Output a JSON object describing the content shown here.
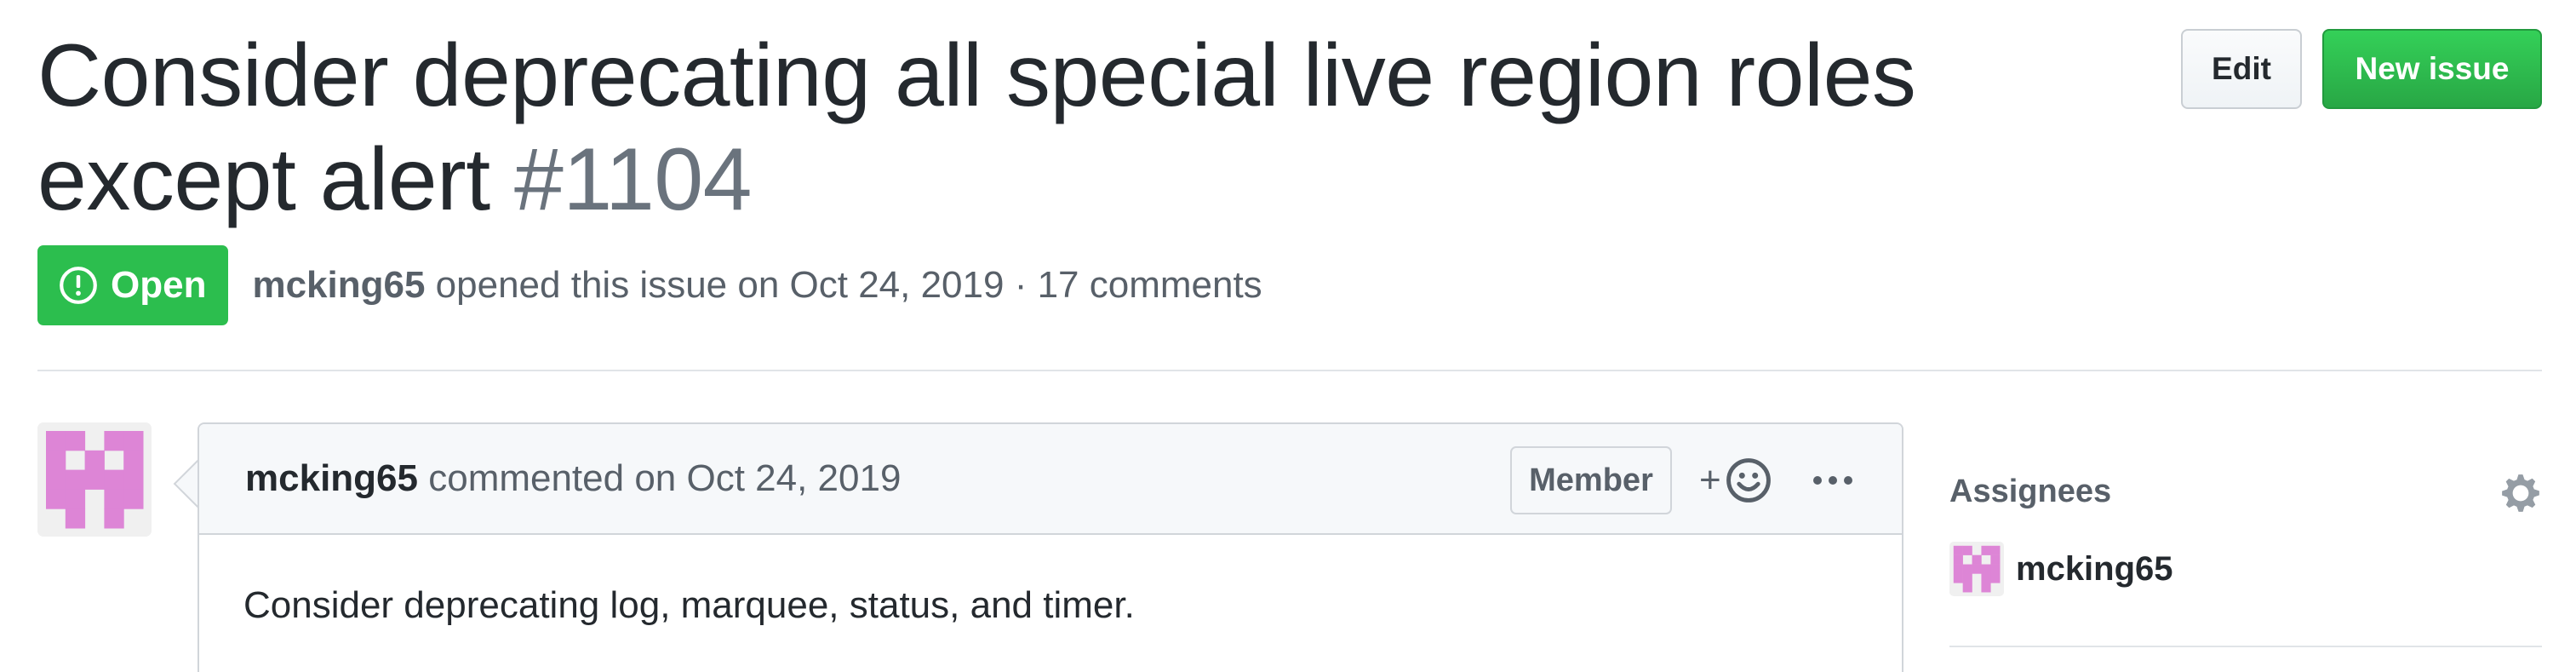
{
  "header": {
    "title": "Consider deprecating all special live region roles except alert",
    "number": "#1104",
    "edit_label": "Edit",
    "new_issue_label": "New issue",
    "status": "Open",
    "author": "mcking65",
    "opened_text": "opened this issue on Oct 24, 2019 · 17 comments"
  },
  "comment": {
    "author": "mcking65",
    "timestamp_text": "commented on Oct 24, 2019",
    "role_badge": "Member",
    "reaction_plus": "+",
    "body": "Consider deprecating log, marquee, status, and timer."
  },
  "sidebar": {
    "assignees_heading": "Assignees",
    "assignees": [
      {
        "name": "mcking65"
      }
    ]
  },
  "icons": {
    "status": "issue-opened-icon",
    "reaction": "smiley-icon",
    "more": "kebab-horizontal-icon",
    "settings": "gear-icon"
  },
  "colors": {
    "open_green": "#2cbe4e",
    "new_issue_green": "#28a745",
    "avatar_pink": "#dd85d6",
    "text_primary": "#24292e",
    "text_muted": "#586069",
    "issue_number_gray": "#6a737d",
    "border": "#d1d5da"
  }
}
